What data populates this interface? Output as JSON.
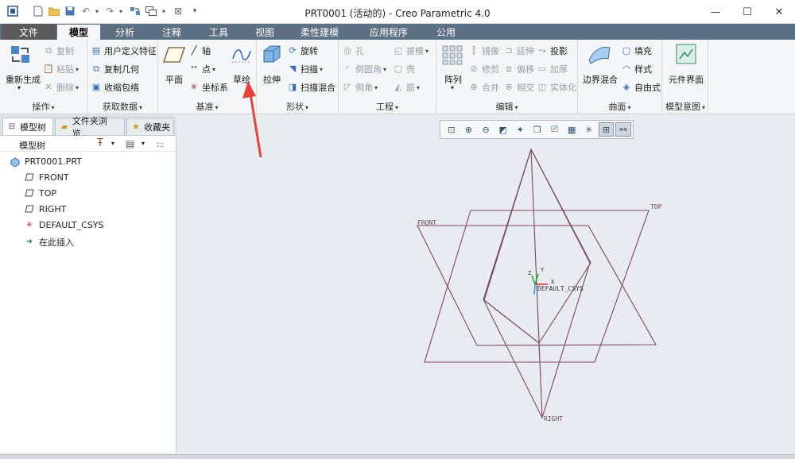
{
  "window": {
    "title": "PRT0001 (活动的) - Creo Parametric 4.0",
    "controls": [
      "—",
      "☐",
      "✕"
    ]
  },
  "tabs": [
    "文件",
    "模型",
    "分析",
    "注释",
    "工具",
    "视图",
    "柔性建模",
    "应用程序",
    "公用"
  ],
  "ribbon": {
    "operations": {
      "label": "操作",
      "regenerate": "重新生成",
      "copy": "复制",
      "paste": "粘贴",
      "delete": "删除"
    },
    "get_data": {
      "label": "获取数据",
      "udf": "用户定义特征",
      "copy_geom": "复制几何",
      "shrinkwrap": "收缩包络"
    },
    "datum": {
      "label": "基准",
      "plane": "平面",
      "axis": "轴",
      "point": "点",
      "csys": "坐标系",
      "sketch": "草绘"
    },
    "shapes": {
      "label": "形状",
      "extrude": "拉伸",
      "revolve": "旋转",
      "sweep": "扫描",
      "swept_blend": "扫描混合"
    },
    "engineering": {
      "label": "工程",
      "hole": "孔",
      "round": "倒圆角",
      "chamfer": "倒角",
      "draft": "拔模",
      "shell": "壳",
      "rib": "筋"
    },
    "editing": {
      "label": "编辑",
      "pattern": "阵列",
      "mirror": "镜像",
      "extend": "延伸",
      "project": "投影",
      "trim": "修剪",
      "offset": "偏移",
      "thicken": "加厚",
      "merge": "合并",
      "intersect": "相交",
      "solidify": "实体化"
    },
    "surfaces": {
      "label": "曲面",
      "boundary_blend": "边界混合",
      "fill": "填充",
      "style": "样式",
      "freestyle": "自由式"
    },
    "model_intent": {
      "label": "模型意图",
      "component_interface": "元件界面"
    }
  },
  "left_panel": {
    "tabs": [
      "模型树",
      "文件夹浏览...",
      "收藏夹"
    ],
    "tree_header": "模型树",
    "items": [
      "PRT0001.PRT",
      "FRONT",
      "TOP",
      "RIGHT",
      "DEFAULT_CSYS",
      "在此插入"
    ]
  },
  "viewport": {
    "datum_labels": {
      "front": "FRONT",
      "top": "TOP",
      "right": "RIGHT",
      "csys": "DEFAULT_CSYS"
    },
    "axis_labels": {
      "x": "X",
      "y": "Y",
      "z": "Z"
    },
    "datum_color": "#7a4a5e",
    "annotation_arrow_color": "#e8403a"
  }
}
